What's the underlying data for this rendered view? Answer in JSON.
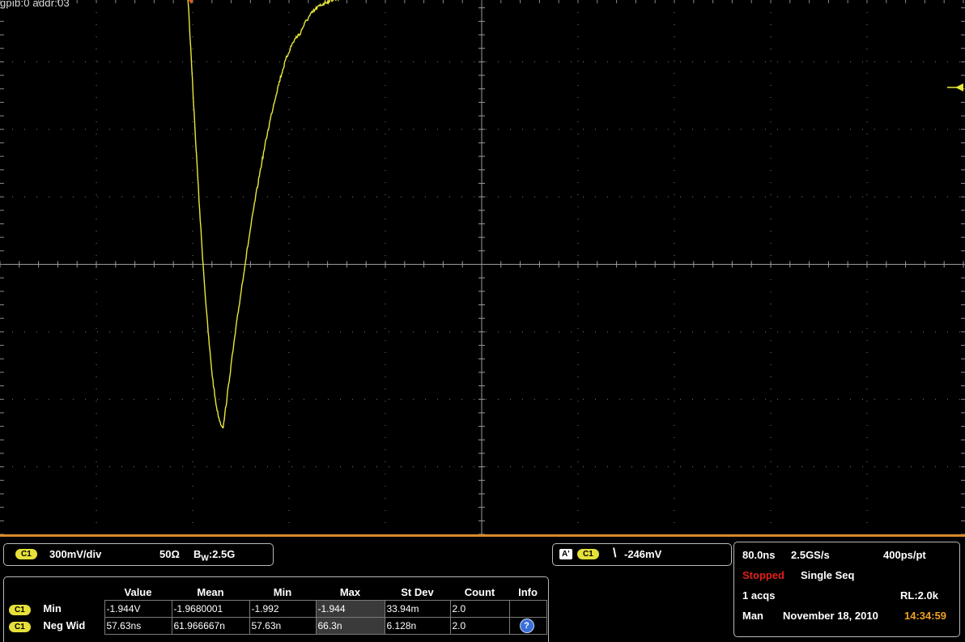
{
  "header": {
    "device_label": "gpib:0  addr:03"
  },
  "waveform": {
    "color": "#e8e83c",
    "grid_color": "#7c7c7c",
    "level_divs_from_center": 4,
    "pulse_min_divs_from_center": -2.4,
    "record_length": 2000
  },
  "vertical": {
    "channel": "C1",
    "scale": "300mV/div",
    "impedance": "50Ω",
    "bw_prefix": "B",
    "bw_sub": "W",
    "bandwidth": ":2.5G"
  },
  "trigger": {
    "source_tag": "A'",
    "channel": "C1",
    "slope_glyph": "\\",
    "level": "-246mV"
  },
  "horizontal": {
    "time_per_div": "80.0ns",
    "sample_rate": "2.5GS/s",
    "resolution": "400ps/pt",
    "state": "Stopped",
    "state_color": "#e0201c",
    "mode": "Single Seq",
    "acqs": "1 acqs",
    "record_length": "RL:2.0k",
    "trigger_mode": "Man",
    "date": "November 18, 2010",
    "time": "14:34:59",
    "time_color": "#f0a020"
  },
  "measurements": {
    "columns": [
      "Value",
      "Mean",
      "Min",
      "Max",
      "St Dev",
      "Count",
      "Info"
    ],
    "rows": [
      {
        "channel": "C1",
        "name": "Min",
        "cells": [
          "-1.944V",
          "-1.9680001",
          "-1.992",
          "-1.944",
          "33.94m",
          "2.0",
          ""
        ]
      },
      {
        "channel": "C1",
        "name": "Neg Wid",
        "cells": [
          "57.63ns",
          "61.966667n",
          "57.63n",
          "66.3n",
          "6.128n",
          "2.0",
          "?"
        ]
      }
    ]
  }
}
